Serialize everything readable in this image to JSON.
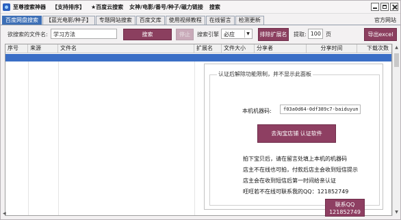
{
  "titlebar": {
    "menu": [
      "至尊搜索神器",
      "【支持排序】",
      "★百度云搜索",
      "女神/电影/番号/种子/磁力链接",
      "搜索"
    ]
  },
  "tabs": [
    "百度网盘搜索",
    "【蓝光电影/种子】",
    "专题网站搜索",
    "百度文库",
    "使用视频教程",
    "在线留言",
    "检测更新"
  ],
  "official_site": "官方网站",
  "toolbar": {
    "search_label": "欲搜索的文件名:",
    "search_value": "学习方法",
    "search_button": "搜索",
    "stop_button": "停止",
    "engine_label": "搜索引擎",
    "engine_value": "必应",
    "rank_button": "排除扩展名",
    "fetch_label": "提取:",
    "fetch_value": "100",
    "fetch_unit": "页",
    "export_button": "导出excel"
  },
  "table": {
    "columns": [
      "序号",
      "来源",
      "文件名",
      "扩展名",
      "文件大小",
      "分享者",
      "分享时间",
      "下载次数"
    ]
  },
  "activation": {
    "legend": "认证后解除功能限制，并不显示此面板",
    "machine_label": "本机机器码:",
    "machine_code": "f03a0d64-0df389c7-baiduyun",
    "taobao_button": "去淘宝店铺 认证软件",
    "instructions": [
      "拍下宝贝后，请在留言处填上本机的机器码",
      "店主不在线也可拍，付款后店主会收到短信提示",
      "店主会在收到短信后第一时间给亲认证",
      "旺旺若不在线可联系我的QQ：121852749"
    ],
    "contact_button_line1": "联系QQ",
    "contact_button_line2": "121852749"
  }
}
